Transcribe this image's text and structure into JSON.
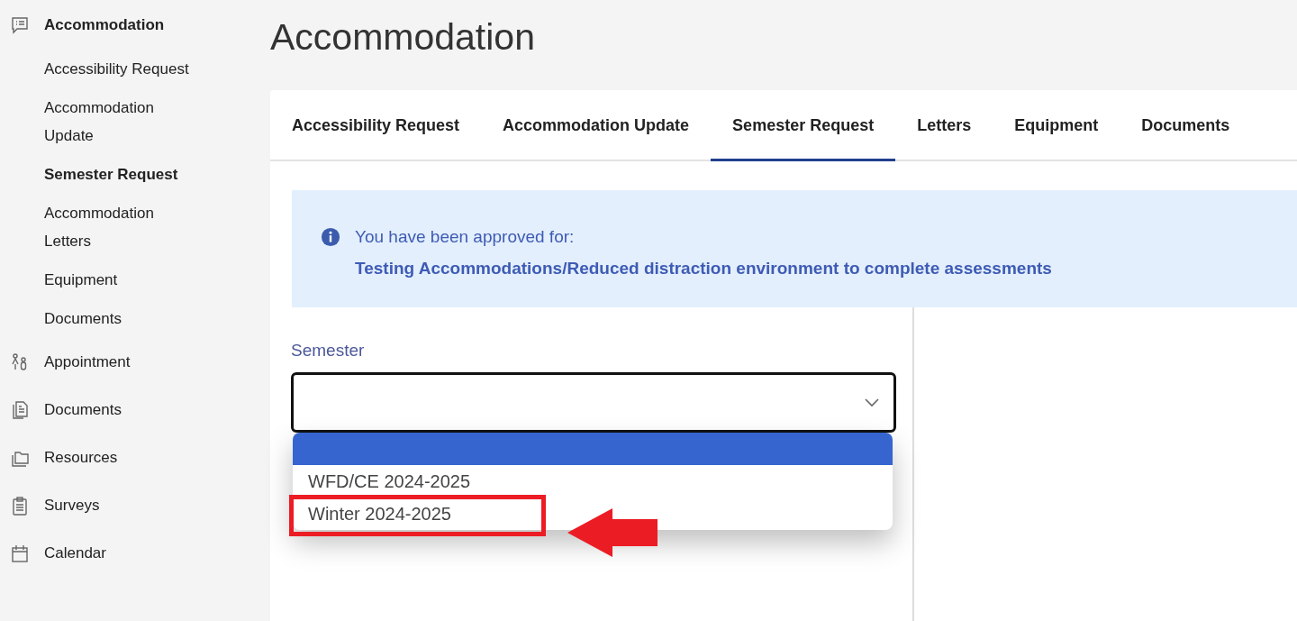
{
  "sidebar": {
    "items": [
      {
        "label": "Accommodation",
        "expanded": true,
        "children": [
          {
            "label": "Accessibility Request",
            "selected": false
          },
          {
            "label": "Accommodation Update",
            "selected": false
          },
          {
            "label": "Semester Request",
            "selected": true
          },
          {
            "label": "Accommodation Letters",
            "selected": false
          },
          {
            "label": "Equipment",
            "selected": false
          },
          {
            "label": "Documents",
            "selected": false
          }
        ]
      },
      {
        "label": "Appointment",
        "expanded": false
      },
      {
        "label": "Documents",
        "expanded": false
      },
      {
        "label": "Resources",
        "expanded": false
      },
      {
        "label": "Surveys",
        "expanded": false
      },
      {
        "label": "Calendar",
        "expanded": false
      }
    ]
  },
  "page": {
    "title": "Accommodation"
  },
  "tabs": [
    {
      "label": "Accessibility Request",
      "selected": false
    },
    {
      "label": "Accommodation Update",
      "selected": false
    },
    {
      "label": "Semester Request",
      "selected": true
    },
    {
      "label": "Letters",
      "selected": false
    },
    {
      "label": "Equipment",
      "selected": false
    },
    {
      "label": "Documents",
      "selected": false
    }
  ],
  "alert": {
    "message": "You have been approved for:",
    "detail": "Testing Accommodations/Reduced distraction environment to complete assessments"
  },
  "semester_field": {
    "label": "Semester",
    "expanded": true,
    "options": [
      {
        "selected": true
      },
      {
        "label": "WFD/CE 2024-2025",
        "selected": false,
        "callout": false
      },
      {
        "label": "Winter 2024-2025",
        "selected": false,
        "callout": true
      }
    ]
  }
}
